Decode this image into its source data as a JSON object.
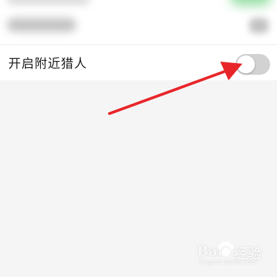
{
  "settings": {
    "nearby_hunter": {
      "label": "开启附近猎人",
      "enabled": false
    }
  },
  "annotation": {
    "arrow_color": "#e8262a",
    "points_to": "toggle-switch"
  },
  "watermark": {
    "text_left": "Bai",
    "text_right": "经验",
    "url": "jingyan.baidu.com"
  },
  "colors": {
    "background": "#f5f5f5",
    "card": "#ffffff",
    "toggle_off": "#d2d2d2"
  }
}
